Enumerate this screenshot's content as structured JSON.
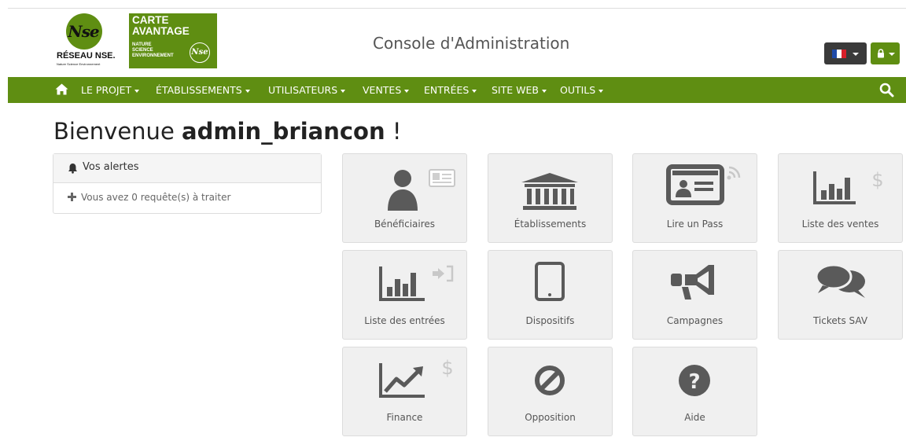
{
  "header": {
    "logo_nse_mark": "Nse",
    "logo_nse_name": "RÉSEAU NSE.",
    "logo_nse_sub": "Nature Science Environnement",
    "carte_line1": "CARTE",
    "carte_line2": "AVANTAGE",
    "carte_small1": "NATURE",
    "carte_small2": "SCIENCE",
    "carte_small3": "ENVIRONNEMENT",
    "carte_badge": "Nse",
    "console_title": "Console d'Administration",
    "language_button_icon": "french-flag-icon",
    "account_button_icon": "lock-icon",
    "colors": {
      "brand_green": "#5f8e12",
      "dark_button": "#3a3a3a"
    }
  },
  "navbar": {
    "home_icon": "home-icon",
    "items": [
      {
        "label": "LE PROJET"
      },
      {
        "label": "ÉTABLISSEMENTS"
      },
      {
        "label": "UTILISATEURS"
      },
      {
        "label": "VENTES"
      },
      {
        "label": "ENTRÉES"
      },
      {
        "label": "SITE WEB"
      },
      {
        "label": "OUTILS"
      }
    ],
    "search_icon": "search-icon"
  },
  "welcome": {
    "prefix": "Bienvenue",
    "username": "admin_briancon",
    "suffix": "!"
  },
  "alerts": {
    "title": "Vos alertes",
    "message": "Vous avez 0 requête(s) à traiter"
  },
  "tiles": [
    {
      "label": "Bénéficiaires",
      "icon": "user-card-icon"
    },
    {
      "label": "Établissements",
      "icon": "institution-icon"
    },
    {
      "label": "Lire un Pass",
      "icon": "id-card-rss-icon"
    },
    {
      "label": "Liste des ventes",
      "icon": "bar-chart-dollar-icon"
    },
    {
      "label": "Liste des entrées",
      "icon": "bar-chart-signin-icon"
    },
    {
      "label": "Dispositifs",
      "icon": "tablet-icon"
    },
    {
      "label": "Campagnes",
      "icon": "megaphone-icon"
    },
    {
      "label": "Tickets SAV",
      "icon": "comments-icon"
    },
    {
      "label": "Finance",
      "icon": "area-chart-dollar-icon"
    },
    {
      "label": "Opposition",
      "icon": "ban-icon"
    },
    {
      "label": "Aide",
      "icon": "question-circle-icon"
    }
  ]
}
